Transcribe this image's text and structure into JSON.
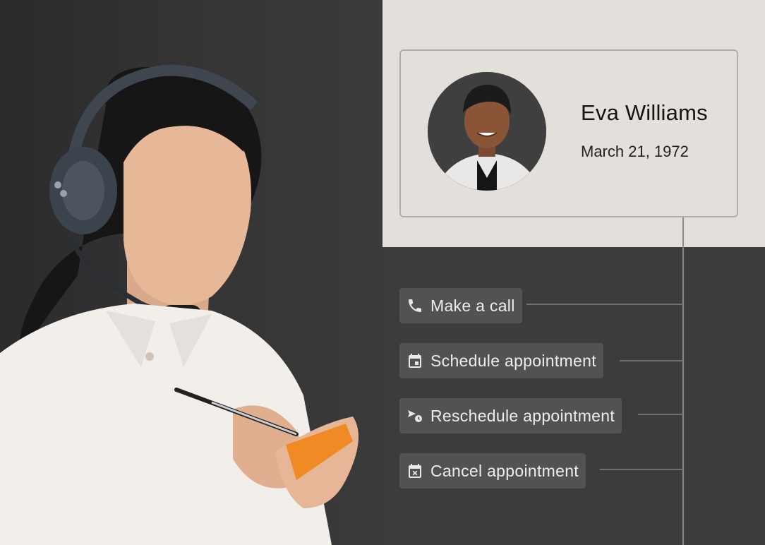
{
  "contact": {
    "name": "Eva Williams",
    "dob": "March 21, 1972"
  },
  "actions": [
    {
      "label": "Make a call",
      "icon": "phone-icon"
    },
    {
      "label": "Schedule appointment",
      "icon": "calendar-icon"
    },
    {
      "label": "Reschedule appointment",
      "icon": "reschedule-icon"
    },
    {
      "label": "Cancel appointment",
      "icon": "calendar-cancel-icon"
    }
  ],
  "colors": {
    "panel_light": "#e3e0db",
    "panel_dark": "#3c3c3c",
    "chip": "#525252"
  }
}
